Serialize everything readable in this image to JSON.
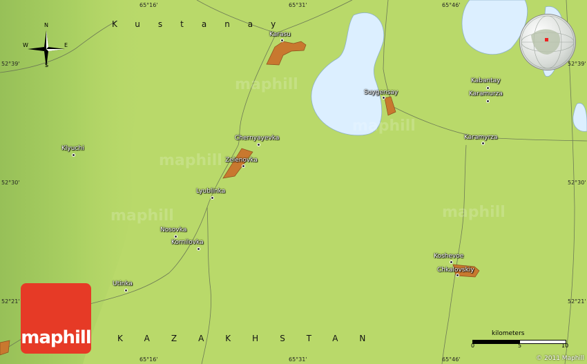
{
  "map": {
    "region_labels": {
      "top": "Kustanay",
      "bottom": "KAZAKHSTAN"
    },
    "coordinates": {
      "top": [
        "65°16'",
        "65°31'",
        "65°46'"
      ],
      "bottom": [
        "65°16'",
        "65°31'",
        "65°46'"
      ],
      "left": [
        "52°39'",
        "52°30'",
        "52°21'"
      ],
      "right": [
        "52°39'",
        "52°30'",
        "52°21'"
      ]
    },
    "places": [
      "Karasu",
      "Suygensay",
      "Kabantay",
      "Karamurza",
      "Chernyayevka",
      "Zelenovka",
      "Karamyrza",
      "Klyuchi",
      "Lyublinka",
      "Nosovka",
      "Kornilovka",
      "Utinka",
      "Koshevoe",
      "Chkalovskiy"
    ],
    "compass": {
      "n": "N",
      "s": "S",
      "e": "E",
      "w": "W"
    },
    "scale": {
      "title": "kilometers",
      "ticks": [
        "0",
        "5",
        "10"
      ]
    },
    "watermark": "maphill",
    "logo": "maphill",
    "copyright": "© 2011 Maphill"
  },
  "colors": {
    "terrain": "#b9d96a",
    "water": "#dcefff",
    "urban": "#c8782f",
    "logo": "#e63a26"
  }
}
